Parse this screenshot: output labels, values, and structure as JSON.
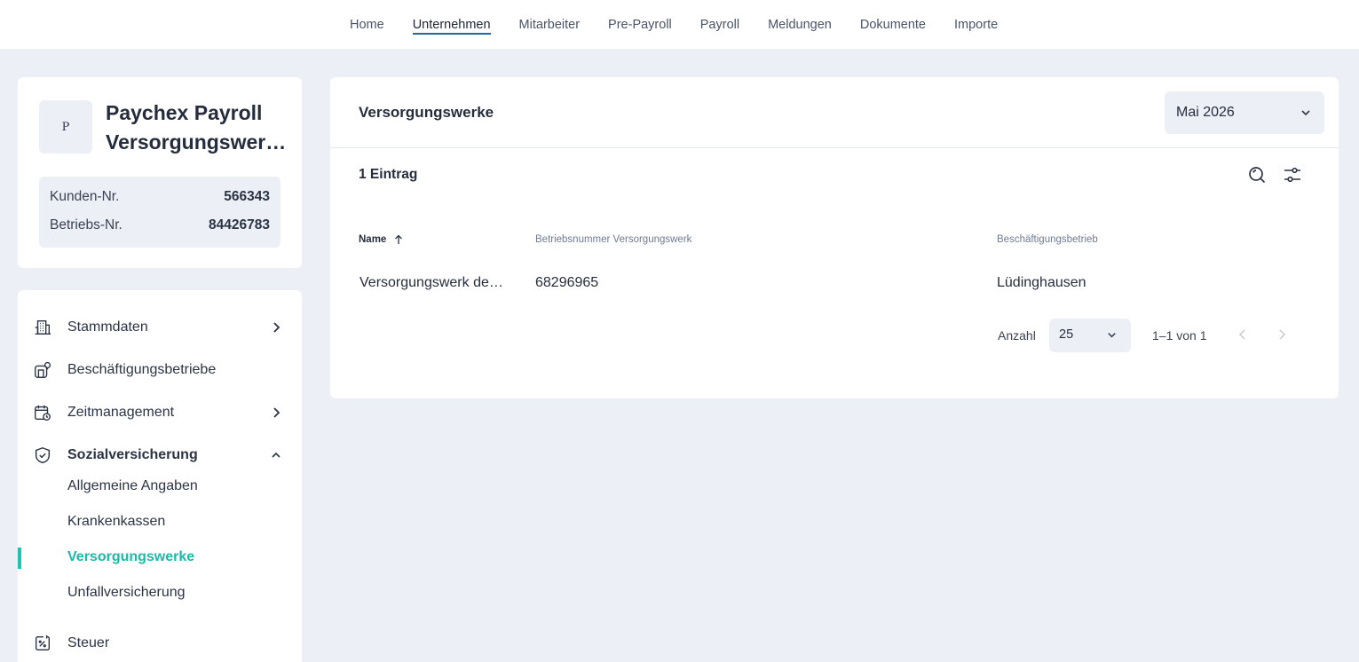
{
  "nav": {
    "tabs": [
      "Home",
      "Unternehmen",
      "Mitarbeiter",
      "Pre-Payroll",
      "Payroll",
      "Meldungen",
      "Dokumente",
      "Importe"
    ],
    "active_tab": "Unternehmen"
  },
  "company": {
    "logo_letter": "P",
    "name_line1": "Paychex Payroll",
    "name_line2": "Versorgungswerke",
    "customer_label": "Kunden-Nr.",
    "customer_number": "566343",
    "business_label": "Betriebs-Nr.",
    "business_number": "84426783"
  },
  "sidebar": {
    "items": [
      {
        "label": "Stammdaten",
        "icon": "building-icon"
      },
      {
        "label": "Beschäftigungsbetriebe",
        "icon": "office-location-icon"
      },
      {
        "label": "Zeitmanagement",
        "icon": "calendar-clock-icon"
      },
      {
        "label": "Sozialversicherung",
        "icon": "shield-icon"
      },
      {
        "label": "Steuer",
        "icon": "tax-percent-icon"
      }
    ],
    "sub_items": [
      "Allgemeine Angaben",
      "Krankenkassen",
      "Versorgungswerke",
      "Unfallversicherung"
    ],
    "active_sub": "Versorgungswerke"
  },
  "main": {
    "title": "Versorgungswerke",
    "month": "Mai 2026",
    "count_label": "1 Eintrag",
    "columns": [
      "Name",
      "Betriebsnummer Versorgungswerk",
      "Beschäftigungsbetrieb"
    ],
    "rows": [
      {
        "name": "Versorgungswerk der Zahnärzte",
        "number": "68296965",
        "betrieb": "Lüdinghausen"
      }
    ],
    "pager": {
      "label": "Anzahl",
      "page_size": "25",
      "range": "1–1 von 1"
    }
  },
  "colors": {
    "accent": "#1fb8a8",
    "nav_underline": "#1a6aa3",
    "background": "#eceff6"
  }
}
